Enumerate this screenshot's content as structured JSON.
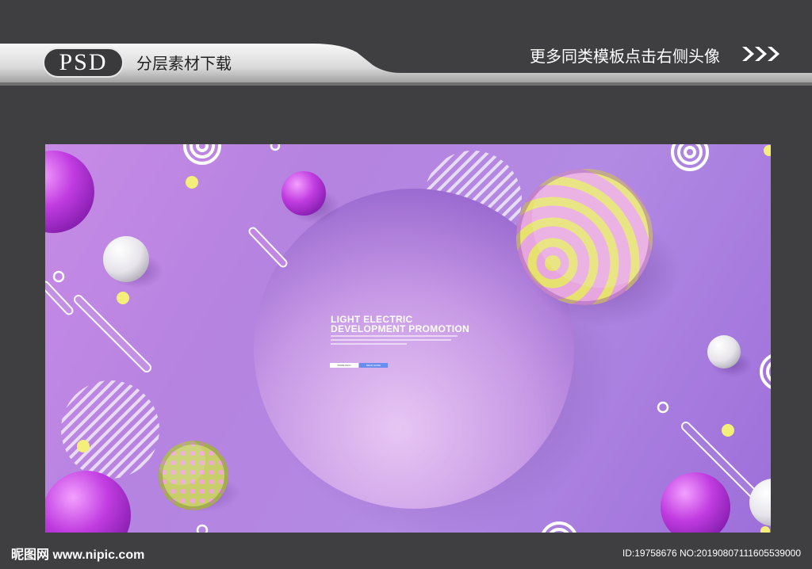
{
  "header": {
    "badge": "PSD",
    "subtitle": "分层素材下载",
    "promo": "更多同类模板点击右侧头像",
    "chevron_icon": "triple-chevron-right-icon"
  },
  "poster": {
    "headline_line1": "LIGHT ELECTRIC",
    "headline_line2": "DEVELOPMENT PROMOTION",
    "button_primary": "MORE INFO",
    "button_secondary": "READ MORE",
    "colors": {
      "bg_start": "#c78be6",
      "bg_end": "#9d6fda",
      "yellow": "#f4ee7a",
      "magenta": "#b72fd8",
      "button_blue": "#6a8df0"
    }
  },
  "footer": {
    "logo": "昵图网 www.nipic.com",
    "id": "ID:19758676 NO:20190807111605539000"
  }
}
